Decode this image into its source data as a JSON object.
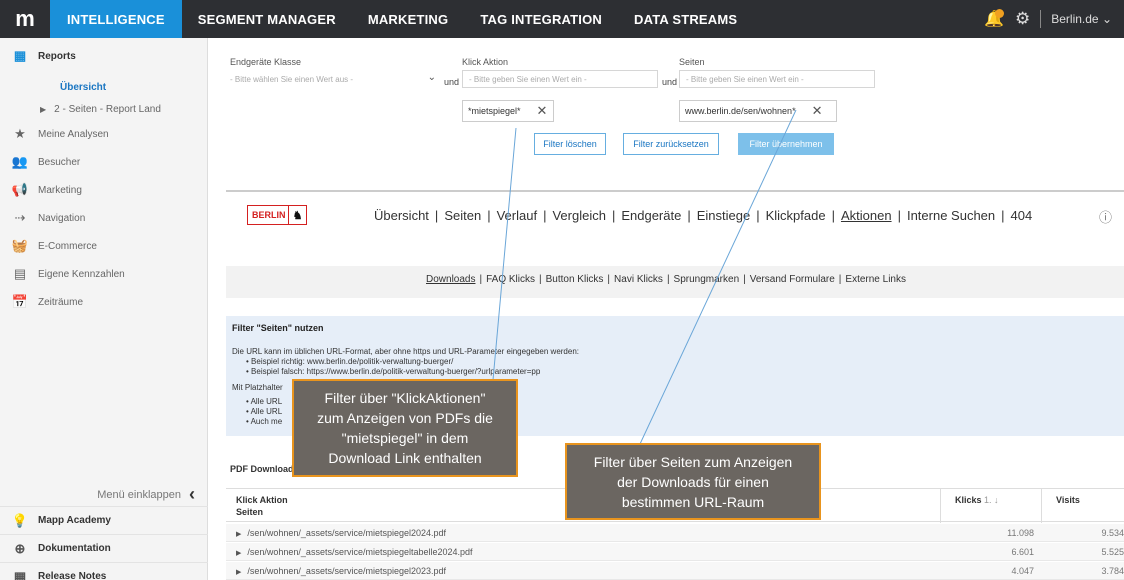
{
  "topbar": {
    "logo": "m",
    "nav": [
      "INTELLIGENCE",
      "SEGMENT MANAGER",
      "MARKETING",
      "TAG INTEGRATION",
      "DATA STREAMS"
    ],
    "account": "Berlin.de"
  },
  "sidebar": {
    "reports": "Reports",
    "uebersicht": "Übersicht",
    "report_land": "2 - Seiten - Report Land",
    "items": [
      "Meine Analysen",
      "Besucher",
      "Marketing",
      "Navigation",
      "E-Commerce",
      "Eigene Kennzahlen",
      "Zeiträume"
    ],
    "collapse": "Menü einklappen",
    "bottom": [
      "Mapp Academy",
      "Dokumentation",
      "Release Notes"
    ]
  },
  "filters": {
    "device_label": "Endgeräte Klasse",
    "device_placeholder": "- Bitte wählen Sie einen Wert aus -",
    "und1": "und",
    "action_label": "Klick Aktion",
    "action_placeholder": "- Bitte geben Sie einen Wert ein -",
    "action_tag": "*mietspiegel*",
    "und2": "und",
    "pages_label": "Seiten",
    "pages_placeholder": "- Bitte geben Sie einen Wert ein -",
    "pages_tag": "www.berlin.de/sen/wohnen*",
    "btn_clear": "Filter löschen",
    "btn_reset": "Filter zurücksetzen",
    "btn_apply": "Filter übernehmen"
  },
  "berlin_nav": {
    "logo": "BERLIN",
    "items": [
      "Übersicht",
      "Seiten",
      "Verlauf",
      "Vergleich",
      "Endgeräte",
      "Einstiege",
      "Klickpfade",
      "Aktionen",
      "Interne Suchen",
      "404"
    ]
  },
  "subnav": {
    "items": [
      "Downloads",
      "FAQ Klicks",
      "Button Klicks",
      "Navi Klicks",
      "Sprungmarken",
      "Versand Formulare",
      "Externe Links"
    ]
  },
  "infobox": {
    "title": "Filter \"Seiten\" nutzen",
    "line1": "Die URL kann im üblichen URL-Format, aber ohne https und URL-Parameter eingegeben werden:",
    "bullet1": "Beispiel richtig: www.berlin.de/politik-verwaltung-buerger/",
    "bullet2": "Beispiel falsch: https://www.berlin.de/politik-verwaltung-buerger/?urlparameter=pp",
    "line2": "Mit Platzhalter",
    "bullet3": "Alle URL",
    "bullet4": "Alle URL",
    "bullet5": "Auch me"
  },
  "callouts": {
    "left": [
      "Filter über \"KlickAktionen\"",
      "zum Anzeigen von PDFs die",
      "\"mietspiegel\" in dem",
      "Download Link enthalten"
    ],
    "right": [
      "Filter über Seiten zum Anzeigen",
      "der Downloads für einen",
      "bestimmen URL-Raum"
    ]
  },
  "table": {
    "title": "PDF Download",
    "col_a": "Klick Aktion",
    "col_b": "Seiten",
    "col_klicks": "Klicks",
    "sort": "1. ↓",
    "col_visits": "Visits",
    "rows": [
      {
        "path": "/sen/wohnen/_assets/service/mietspiegel2024.pdf",
        "klicks": "11.098",
        "visits": "9.534"
      },
      {
        "path": "/sen/wohnen/_assets/service/mietspiegeltabelle2024.pdf",
        "klicks": "6.601",
        "visits": "5.525"
      },
      {
        "path": "/sen/wohnen/_assets/service/mietspiegel2023.pdf",
        "klicks": "4.047",
        "visits": "3.784"
      }
    ]
  },
  "colors": {
    "accent": "#1a90d9",
    "topbar": "#2d2f33",
    "callout_border": "#e8941e",
    "callout_bg": "#6b6661"
  }
}
